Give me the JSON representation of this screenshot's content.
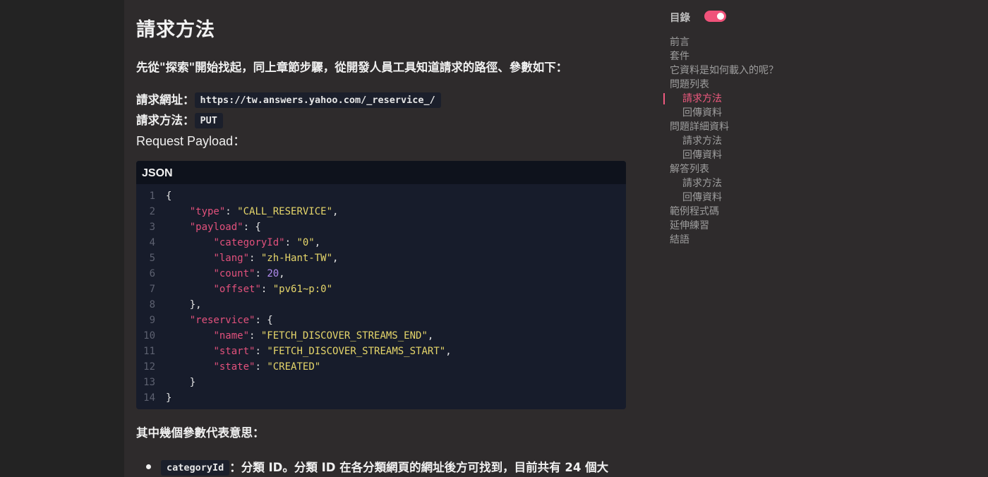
{
  "article": {
    "title": "請求方法",
    "intro_prefix": "先從\"探索\"開始找起，同上章節步驟，從",
    "intro_bold": "開發人員工具",
    "intro_suffix": "知道請求的路徑、參數如下：",
    "url_label": "請求網址：",
    "url_value": "https://tw.answers.yahoo.com/_reservice_/",
    "method_label": "請求方法：",
    "method_value": "PUT",
    "payload_label": "Request Payload：",
    "code_lang": "JSON",
    "code_lines": [
      [
        {
          "t": "p",
          "v": "{"
        }
      ],
      [
        {
          "t": "p",
          "v": "    "
        },
        {
          "t": "k",
          "v": "\"type\""
        },
        {
          "t": "p",
          "v": ": "
        },
        {
          "t": "s",
          "v": "\"CALL_RESERVICE\""
        },
        {
          "t": "p",
          "v": ","
        }
      ],
      [
        {
          "t": "p",
          "v": "    "
        },
        {
          "t": "k",
          "v": "\"payload\""
        },
        {
          "t": "p",
          "v": ": {"
        }
      ],
      [
        {
          "t": "p",
          "v": "        "
        },
        {
          "t": "k",
          "v": "\"categoryId\""
        },
        {
          "t": "p",
          "v": ": "
        },
        {
          "t": "s",
          "v": "\"0\""
        },
        {
          "t": "p",
          "v": ","
        }
      ],
      [
        {
          "t": "p",
          "v": "        "
        },
        {
          "t": "k",
          "v": "\"lang\""
        },
        {
          "t": "p",
          "v": ": "
        },
        {
          "t": "s",
          "v": "\"zh-Hant-TW\""
        },
        {
          "t": "p",
          "v": ","
        }
      ],
      [
        {
          "t": "p",
          "v": "        "
        },
        {
          "t": "k",
          "v": "\"count\""
        },
        {
          "t": "p",
          "v": ": "
        },
        {
          "t": "n",
          "v": "20"
        },
        {
          "t": "p",
          "v": ","
        }
      ],
      [
        {
          "t": "p",
          "v": "        "
        },
        {
          "t": "k",
          "v": "\"offset\""
        },
        {
          "t": "p",
          "v": ": "
        },
        {
          "t": "s",
          "v": "\"pv61~p:0\""
        }
      ],
      [
        {
          "t": "p",
          "v": "    },"
        }
      ],
      [
        {
          "t": "p",
          "v": "    "
        },
        {
          "t": "k",
          "v": "\"reservice\""
        },
        {
          "t": "p",
          "v": ": {"
        }
      ],
      [
        {
          "t": "p",
          "v": "        "
        },
        {
          "t": "k",
          "v": "\"name\""
        },
        {
          "t": "p",
          "v": ": "
        },
        {
          "t": "s",
          "v": "\"FETCH_DISCOVER_STREAMS_END\""
        },
        {
          "t": "p",
          "v": ","
        }
      ],
      [
        {
          "t": "p",
          "v": "        "
        },
        {
          "t": "k",
          "v": "\"start\""
        },
        {
          "t": "p",
          "v": ": "
        },
        {
          "t": "s",
          "v": "\"FETCH_DISCOVER_STREAMS_START\""
        },
        {
          "t": "p",
          "v": ","
        }
      ],
      [
        {
          "t": "p",
          "v": "        "
        },
        {
          "t": "k",
          "v": "\"state\""
        },
        {
          "t": "p",
          "v": ": "
        },
        {
          "t": "s",
          "v": "\"CREATED\""
        }
      ],
      [
        {
          "t": "p",
          "v": "    }"
        }
      ],
      [
        {
          "t": "p",
          "v": "}"
        }
      ]
    ],
    "params_heading": "其中幾個參數代表意思：",
    "bullet_code": "categoryId",
    "bullet_text": "：分類 ID。分類 ID 在各分類網頁的網址後方可找到，目前共有 24 個大"
  },
  "toc": {
    "title": "目錄",
    "toggle_on": true,
    "items": [
      {
        "label": "前言",
        "level": 1,
        "active": false
      },
      {
        "label": "套件",
        "level": 1,
        "active": false
      },
      {
        "label": "它資料是如何載入的呢？",
        "level": 1,
        "active": false
      },
      {
        "label": "問題列表",
        "level": 1,
        "active": false
      },
      {
        "label": "請求方法",
        "level": 2,
        "active": true
      },
      {
        "label": "回傳資料",
        "level": 2,
        "active": false
      },
      {
        "label": "問題詳細資料",
        "level": 1,
        "active": false
      },
      {
        "label": "請求方法",
        "level": 2,
        "active": false
      },
      {
        "label": "回傳資料",
        "level": 2,
        "active": false
      },
      {
        "label": "解答列表",
        "level": 1,
        "active": false
      },
      {
        "label": "請求方法",
        "level": 2,
        "active": false
      },
      {
        "label": "回傳資料",
        "level": 2,
        "active": false
      },
      {
        "label": "範例程式碼",
        "level": 1,
        "active": false
      },
      {
        "label": "延伸練習",
        "level": 1,
        "active": false
      },
      {
        "label": "結語",
        "level": 1,
        "active": false
      }
    ]
  },
  "colors": {
    "accent": "#ef5a7f",
    "json_key": "#e2517c",
    "json_string": "#e6d66a",
    "json_number": "#b28cf0"
  }
}
